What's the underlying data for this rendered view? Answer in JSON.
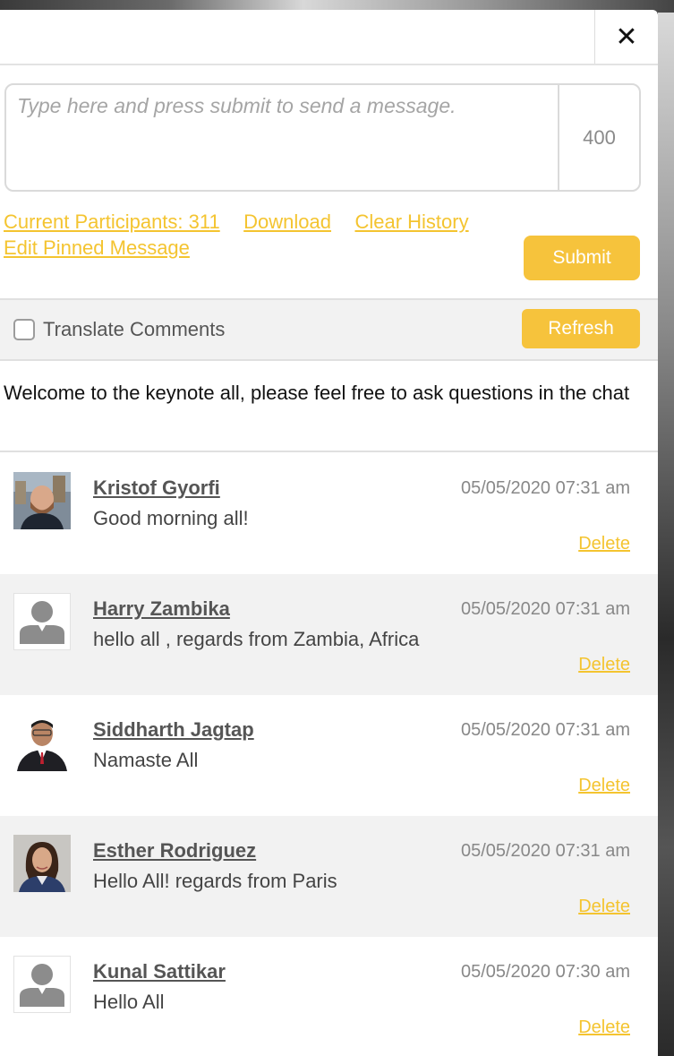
{
  "header": {
    "close_glyph": "✕"
  },
  "composer": {
    "placeholder": "Type here and press submit to send a message.",
    "char_count": "400",
    "submit_label": "Submit"
  },
  "links": {
    "participants": "Current Participants: 311",
    "download": "Download",
    "clear_history": "Clear History",
    "edit_pinned": "Edit Pinned Message"
  },
  "translate": {
    "label": "Translate Comments",
    "checked": false,
    "refresh_label": "Refresh"
  },
  "pinned_message": "Welcome to the keynote all, please feel free to ask questions in the chat",
  "accent_color": "#f6c33c",
  "messages": [
    {
      "name": "Kristof Gyorfi",
      "timestamp": "05/05/2020 07:31 am",
      "text": "Good morning all!",
      "delete_label": "Delete",
      "avatar": "photo-man-beard"
    },
    {
      "name": "Harry Zambika",
      "timestamp": "05/05/2020 07:31 am",
      "text": "hello all , regards from Zambia, Africa",
      "delete_label": "Delete",
      "avatar": "default-person"
    },
    {
      "name": "Siddharth Jagtap",
      "timestamp": "05/05/2020 07:31 am",
      "text": "Namaste All",
      "delete_label": "Delete",
      "avatar": "photo-man-suit"
    },
    {
      "name": "Esther Rodriguez",
      "timestamp": "05/05/2020 07:31 am",
      "text": "Hello All! regards from Paris",
      "delete_label": "Delete",
      "avatar": "photo-woman"
    },
    {
      "name": "Kunal Sattikar",
      "timestamp": "05/05/2020 07:30 am",
      "text": "Hello All",
      "delete_label": "Delete",
      "avatar": "default-person"
    }
  ]
}
